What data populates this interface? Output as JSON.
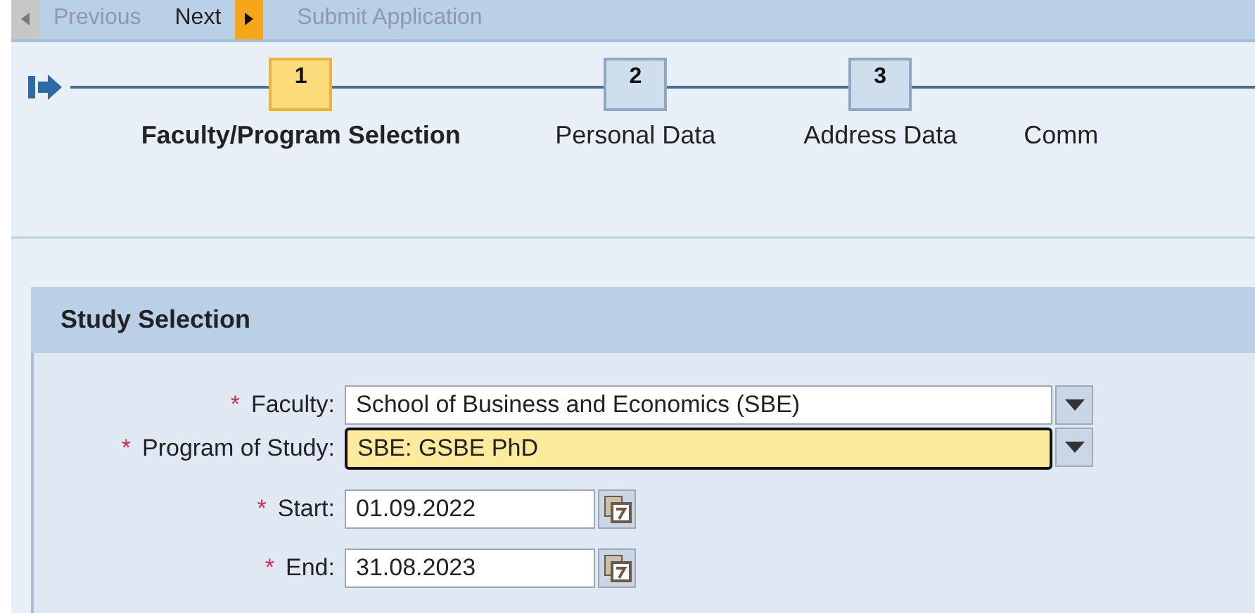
{
  "toolbar": [
    {
      "label": "Previous",
      "kind": "previous",
      "disabled": true
    },
    {
      "label": "Next",
      "kind": "next",
      "disabled": false
    },
    {
      "label": "Submit Application",
      "kind": "plain",
      "disabled": true
    }
  ],
  "steps": [
    {
      "number": "1",
      "label": "Faculty/Program Selection",
      "selected": true
    },
    {
      "number": "2",
      "label": "Personal Data",
      "selected": false
    },
    {
      "number": "3",
      "label": "Address Data",
      "selected": false
    },
    {
      "label": "Comm",
      "selected": false
    }
  ],
  "section": {
    "title": "Study Selection",
    "fields": [
      {
        "kind": "dropdown",
        "label": "Faculty:",
        "required_mark": "*",
        "value": "School of Business and Economics (SBE)",
        "focused": false
      },
      {
        "kind": "dropdown",
        "label": "Program of Study:",
        "required_mark": "*",
        "value": "SBE: GSBE PhD",
        "focused": true
      },
      {
        "kind": "date",
        "label": "Start:",
        "required_mark": "*",
        "value": "01.09.2022",
        "focused": false
      },
      {
        "kind": "date",
        "label": "End:",
        "required_mark": "*",
        "value": "31.08.2023",
        "focused": false
      }
    ]
  }
}
